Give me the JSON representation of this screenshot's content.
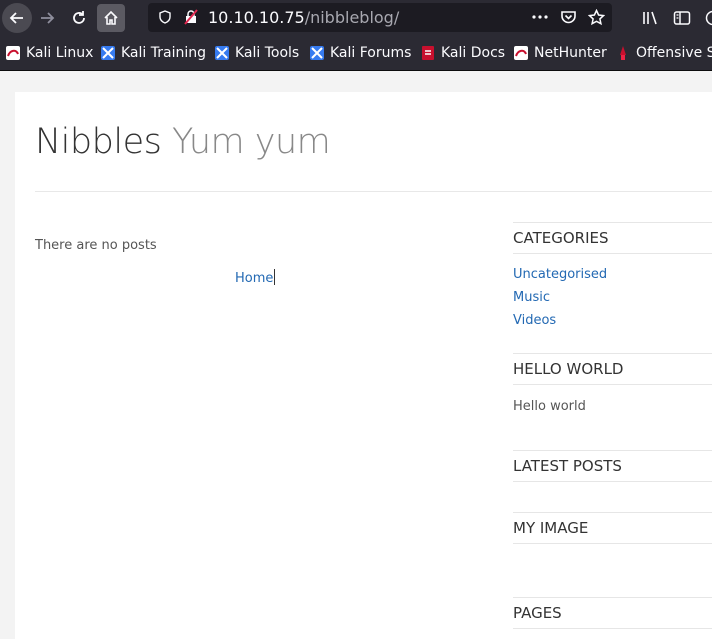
{
  "browser": {
    "url_host": "10.10.10.75",
    "url_path": "/nibbleblog/",
    "icons": [
      "back-icon",
      "forward-icon",
      "reload-icon",
      "home-icon",
      "shield-icon",
      "insecure-lock-icon",
      "more-icon",
      "pocket-icon",
      "bookmark-star-icon",
      "library-icon",
      "sidebar-icon"
    ]
  },
  "bookmarks": [
    {
      "label": "Kali Linux",
      "icon": "kali-icon"
    },
    {
      "label": "Kali Training",
      "icon": "kali-training-icon"
    },
    {
      "label": "Kali Tools",
      "icon": "kali-tools-icon"
    },
    {
      "label": "Kali Forums",
      "icon": "kali-forums-icon"
    },
    {
      "label": "Kali Docs",
      "icon": "kali-docs-icon"
    },
    {
      "label": "NetHunter",
      "icon": "nethunter-icon"
    },
    {
      "label": "Offensive Se",
      "icon": "offsec-icon"
    }
  ],
  "site": {
    "name": "Nibbles",
    "slogan": "Yum yum"
  },
  "main": {
    "empty_text": "There are no posts",
    "home_link": "Home"
  },
  "sidebar": {
    "categories_title": "CATEGORIES",
    "categories": [
      "Uncategorised",
      "Music",
      "Videos"
    ],
    "hello_title": "HELLO WORLD",
    "hello_text": "Hello world",
    "latest_title": "LATEST POSTS",
    "image_title": "MY IMAGE",
    "pages_title": "PAGES"
  },
  "colors": {
    "chrome": "#2b2a33",
    "link": "#2369b3"
  }
}
